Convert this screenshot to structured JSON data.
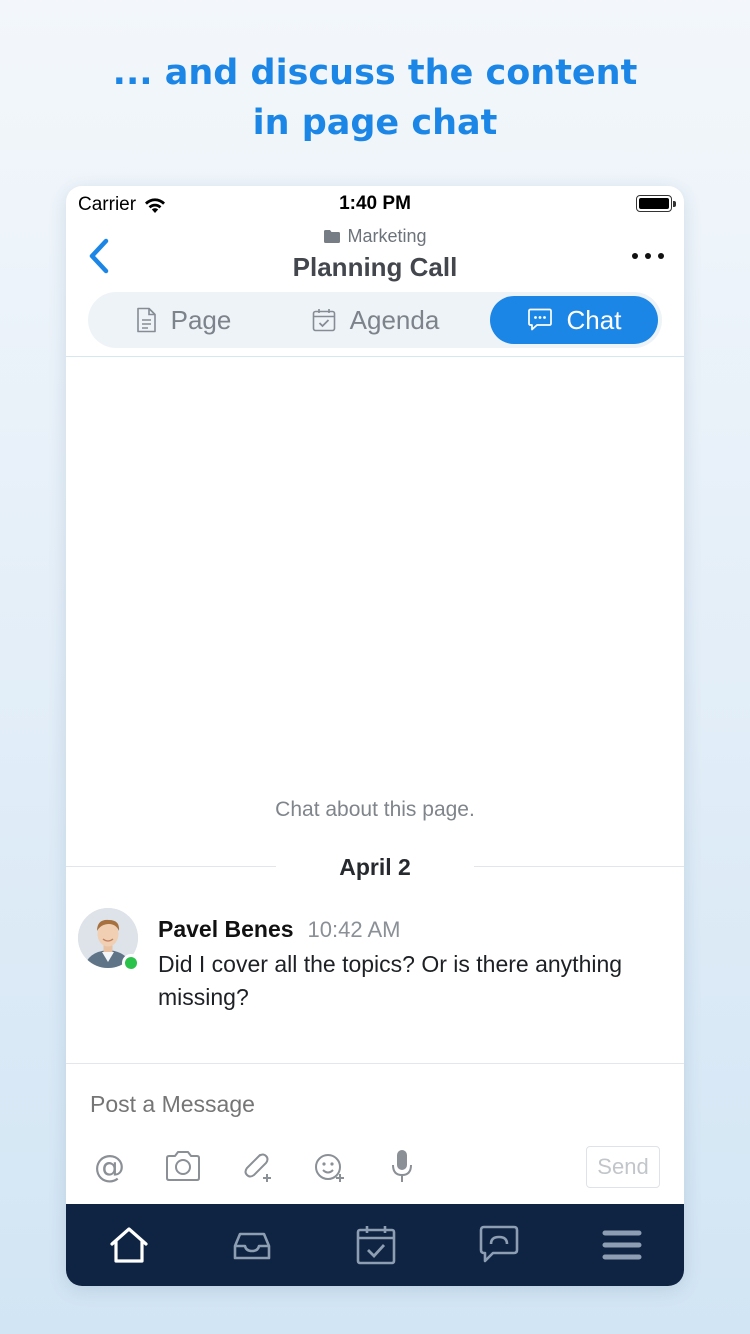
{
  "headline": {
    "line1": "... and discuss the content",
    "line2": "in page chat"
  },
  "status_bar": {
    "carrier": "Carrier",
    "time": "1:40 PM"
  },
  "nav": {
    "folder": "Marketing",
    "title": "Planning Call"
  },
  "tabs": [
    {
      "label": "Page",
      "icon": "document-icon",
      "active": false
    },
    {
      "label": "Agenda",
      "icon": "calendar-check-icon",
      "active": false
    },
    {
      "label": "Chat",
      "icon": "chat-bubble-icon",
      "active": true
    }
  ],
  "chat": {
    "empty_note": "Chat about this page.",
    "date_separator": "April 2",
    "messages": [
      {
        "sender": "Pavel Benes",
        "time": "10:42 AM",
        "text": "Did I cover all the topics? Or is there anything missing?",
        "online": true
      }
    ]
  },
  "composer": {
    "placeholder": "Post a Message",
    "send_label": "Send",
    "tools": [
      "at-icon",
      "camera-icon",
      "attachment-icon",
      "emoji-icon",
      "microphone-icon"
    ]
  },
  "bottom_nav": [
    "home-icon",
    "inbox-icon",
    "calendar-icon",
    "chats-icon",
    "menu-icon"
  ],
  "colors": {
    "accent": "#1b86e6",
    "tabbar": "#0e2442",
    "presence": "#2bc24b"
  }
}
